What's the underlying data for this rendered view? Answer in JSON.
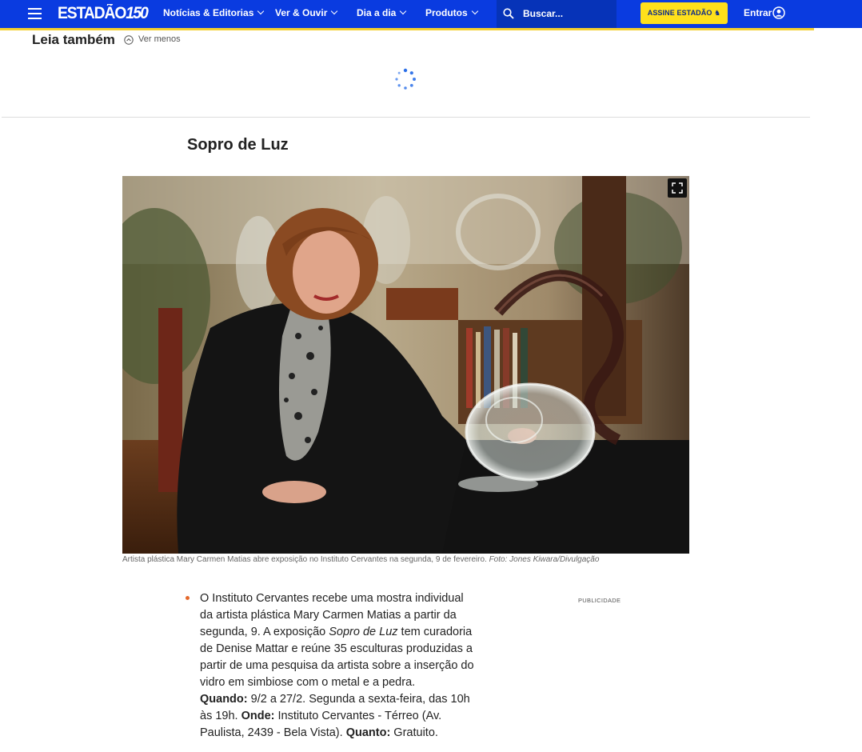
{
  "header": {
    "logo": "ESTADÃO",
    "logo_number": "150",
    "nav": [
      "Notícias & Editorias",
      "Ver & Ouvir",
      "Dia a dia",
      "Produtos"
    ],
    "search_placeholder": "Buscar...",
    "subscribe_label": "ASSINE ESTADÃO",
    "login_label": "Entrar",
    "colors": {
      "bar": "#0a3be0",
      "accent": "#f4cf2e",
      "subscribe_bg": "#ffe01b"
    }
  },
  "related": {
    "heading": "Leia também",
    "toggle_label": "Ver menos"
  },
  "article": {
    "section_title": "Sopro de Luz",
    "photo_caption": "Artista plástica Mary Carmen Matias abre exposição no Instituto Cervantes na segunda, 9 de fevereiro.",
    "photo_credit": "Foto: Jones Kiwara/Divulgação",
    "body": {
      "p1": "O Instituto Cervantes recebe uma mostra individual da artista plástica Mary Carmen Matias a partir da segunda, 9. A exposição ",
      "p1_em": "Sopro de Luz",
      "p1_end": " tem curadoria de Denise Mattar e reúne 35 esculturas produzidas a partir de uma pesquisa da artista sobre a inserção do vidro em simbiose com o metal e a pedra.",
      "when_label": "Quando:",
      "when_value": " 9/2 a 27/2. Segunda a sexta-feira, das 10h às 19h. ",
      "where_label": "Onde:",
      "where_value": " Instituto Cervantes - Térreo (Av. Paulista, 2439 - Bela Vista). ",
      "price_label": "Quanto:",
      "price_value": " Gratuito."
    },
    "ad_label": "PUBLICIDADE",
    "bullet_color": "#e4682a"
  }
}
